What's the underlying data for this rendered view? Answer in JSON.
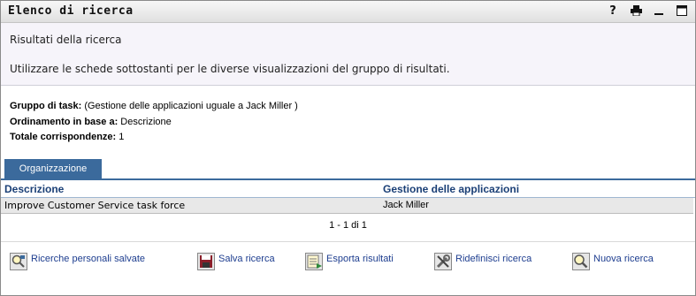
{
  "titlebar": {
    "title": "Elenco di ricerca",
    "icons": [
      "help-icon",
      "print-icon",
      "minimize-icon",
      "maximize-icon"
    ]
  },
  "header": {
    "subtitle": "Risultati della ricerca",
    "instructions": "Utilizzare le schede sottostanti per le diverse visualizzazioni del gruppo di risultati."
  },
  "info": {
    "task_group_label": "Gruppo di task:",
    "task_group_value": " (Gestione delle applicazioni uguale a Jack Miller )",
    "order_label": "Ordinamento in base a:",
    "order_value": " Descrizione",
    "total_label": "Totale corrispondenze:",
    "total_value": " 1"
  },
  "tabs": [
    {
      "label": "Organizzazione",
      "active": true
    }
  ],
  "table": {
    "columns": [
      "Descrizione",
      "Gestione delle applicazioni"
    ],
    "rows": [
      [
        "Improve Customer Service task force",
        "Jack Miller"
      ]
    ]
  },
  "pager": "1 - 1 di 1",
  "actions": [
    {
      "label": "Ricerche personali salvate",
      "icon": "saved-searches-icon"
    },
    {
      "label": "Salva ricerca",
      "icon": "save-icon"
    },
    {
      "label": "Esporta risultati",
      "icon": "export-icon"
    },
    {
      "label": "Ridefinisci ricerca",
      "icon": "refine-search-icon"
    },
    {
      "label": "Nuova ricerca",
      "icon": "new-search-icon"
    }
  ],
  "colors": {
    "tab": "#3b6a9c",
    "link": "#1d3d8f",
    "header_text": "#1a3f76",
    "row_bg": "#e8e8e8"
  }
}
